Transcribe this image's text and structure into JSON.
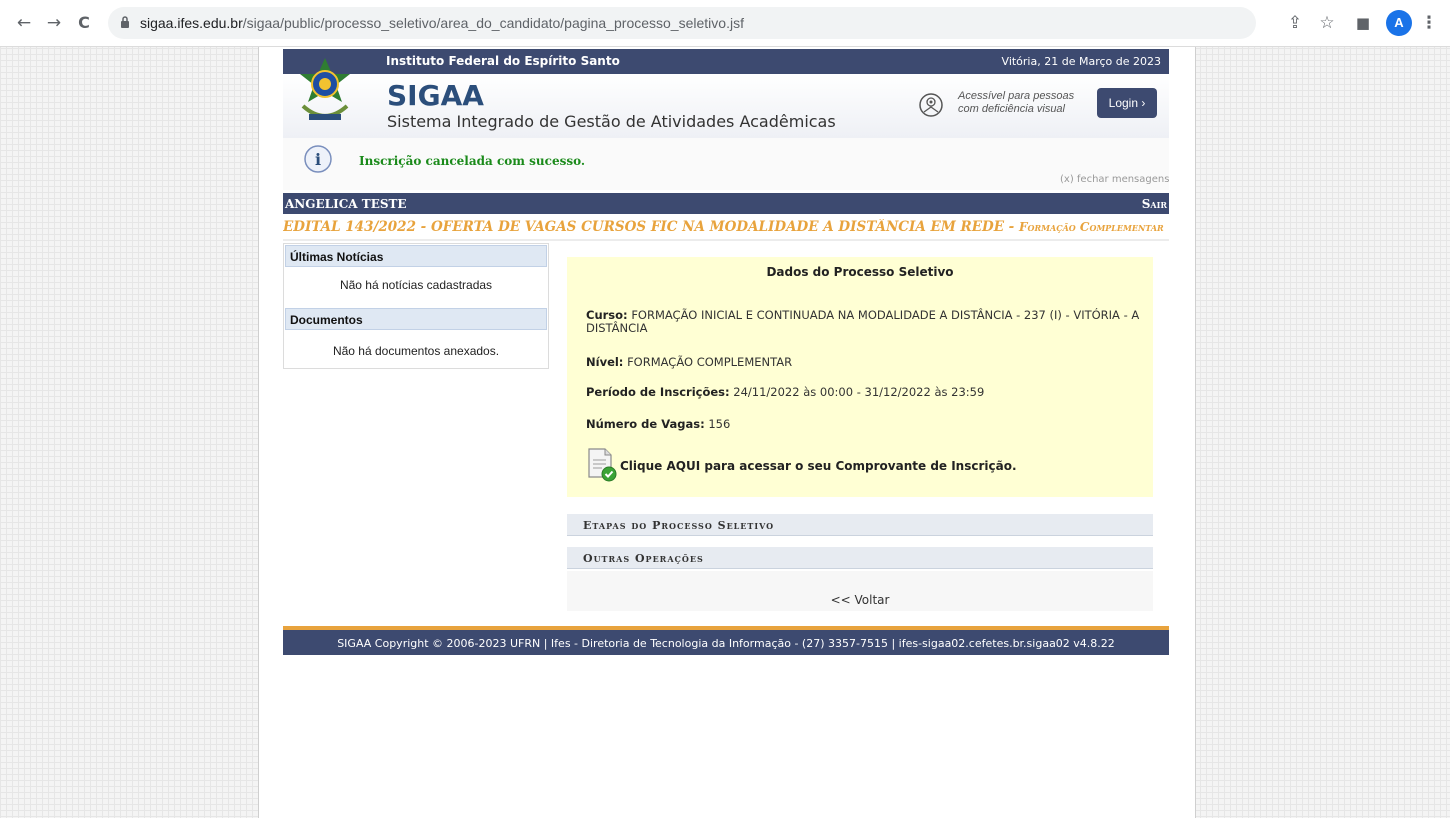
{
  "browser": {
    "url_host": "sigaa.ifes.edu.br",
    "url_path": "/sigaa/public/processo_seletivo/area_do_candidato/pagina_processo_seletivo.jsf",
    "profile_initial": "A"
  },
  "header": {
    "institution": "Instituto Federal do Espírito Santo",
    "date": "Vitória, 21 de Março de 2023",
    "logo": "SIGAA",
    "subtitle": "Sistema Integrado de Gestão de Atividades Acadêmicas",
    "accessibility_text": "Acessível para pessoas com deficiência visual",
    "login_label": "Login  ›"
  },
  "message": {
    "text": "Inscrição cancelada com sucesso.",
    "close_label": "(x) fechar mensagens"
  },
  "userbar": {
    "username": "ANGELICA TESTE",
    "logout_label": "Sair"
  },
  "edital": {
    "title": "EDITAL 143/2022 - OFERTA DE VAGAS CURSOS FIC NA MODALIDADE A DISTÂNCIA EM REDE - ",
    "level": "Formação Complementar"
  },
  "sidebar": {
    "news_header": "Últimas Notícias",
    "news_empty": "Não há notícias cadastradas",
    "docs_header": "Documentos",
    "docs_empty": "Não há documentos anexados."
  },
  "process": {
    "title": "Dados do Processo Seletivo",
    "curso_label": "Curso:",
    "curso_value": "FORMAÇÃO INICIAL E CONTINUADA NA MODALIDADE A DISTÂNCIA - 237 (I) - VITÓRIA - A DISTÂNCIA",
    "nivel_label": "Nível:",
    "nivel_value": "FORMAÇÃO COMPLEMENTAR",
    "periodo_label": "Período de Inscrições:",
    "periodo_value": "24/11/2022 às 00:00 - 31/12/2022 às 23:59",
    "vagas_label": "Número de Vagas:",
    "vagas_value": "156",
    "comprovante_link": "Clique AQUI para acessar o seu Comprovante de Inscrição."
  },
  "sections": {
    "etapas": "Etapas do Processo Seletivo",
    "outras": "Outras Operações"
  },
  "back_label": "<< Voltar",
  "footer": {
    "text": "SIGAA Copyright © 2006-2023 UFRN | Ifes - Diretoria de Tecnologia da Informação - (27) 3357-7515 | ifes-sigaa02.cefetes.br.sigaa02 v4.8.22"
  },
  "colors": {
    "navy": "#3d4a70",
    "orange": "#e8a33d",
    "success_green": "#1a8a1a",
    "highlight_yellow": "#ffffd4"
  }
}
